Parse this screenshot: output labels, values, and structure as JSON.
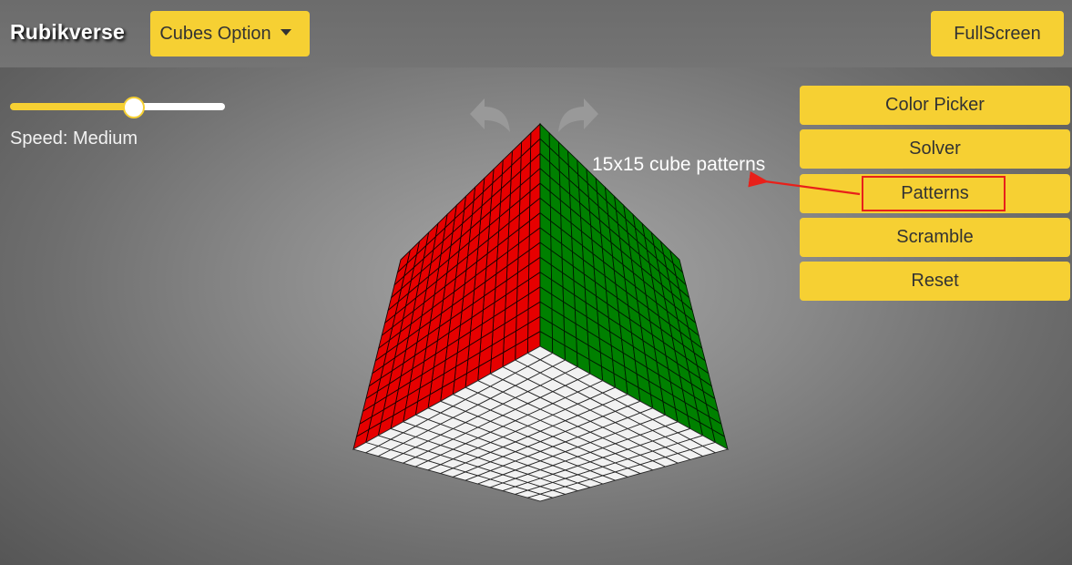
{
  "app": {
    "brand": "Rubikverse"
  },
  "header": {
    "cubes_option_label": "Cubes Option",
    "fullscreen_label": "FullScreen"
  },
  "controls": {
    "speed_label": "Speed: Medium",
    "speed_level": 0.57
  },
  "side_menu": {
    "items": [
      {
        "label": "Color Picker"
      },
      {
        "label": "Solver"
      },
      {
        "label": "Patterns"
      },
      {
        "label": "Scramble"
      },
      {
        "label": "Reset"
      }
    ]
  },
  "annotation": {
    "text": "15x15 cube patterns",
    "arrow_color": "#e8201a"
  },
  "cube": {
    "size": 15,
    "faces": {
      "left": "#e60000",
      "right": "#008000",
      "bottom": "#f2f2f2"
    }
  },
  "icons": {
    "rotate_left": "rotate-left-arrow-icon",
    "rotate_right": "rotate-right-arrow-icon",
    "dropdown": "caret-down-icon"
  },
  "theme": {
    "accent": "#f6d033"
  }
}
